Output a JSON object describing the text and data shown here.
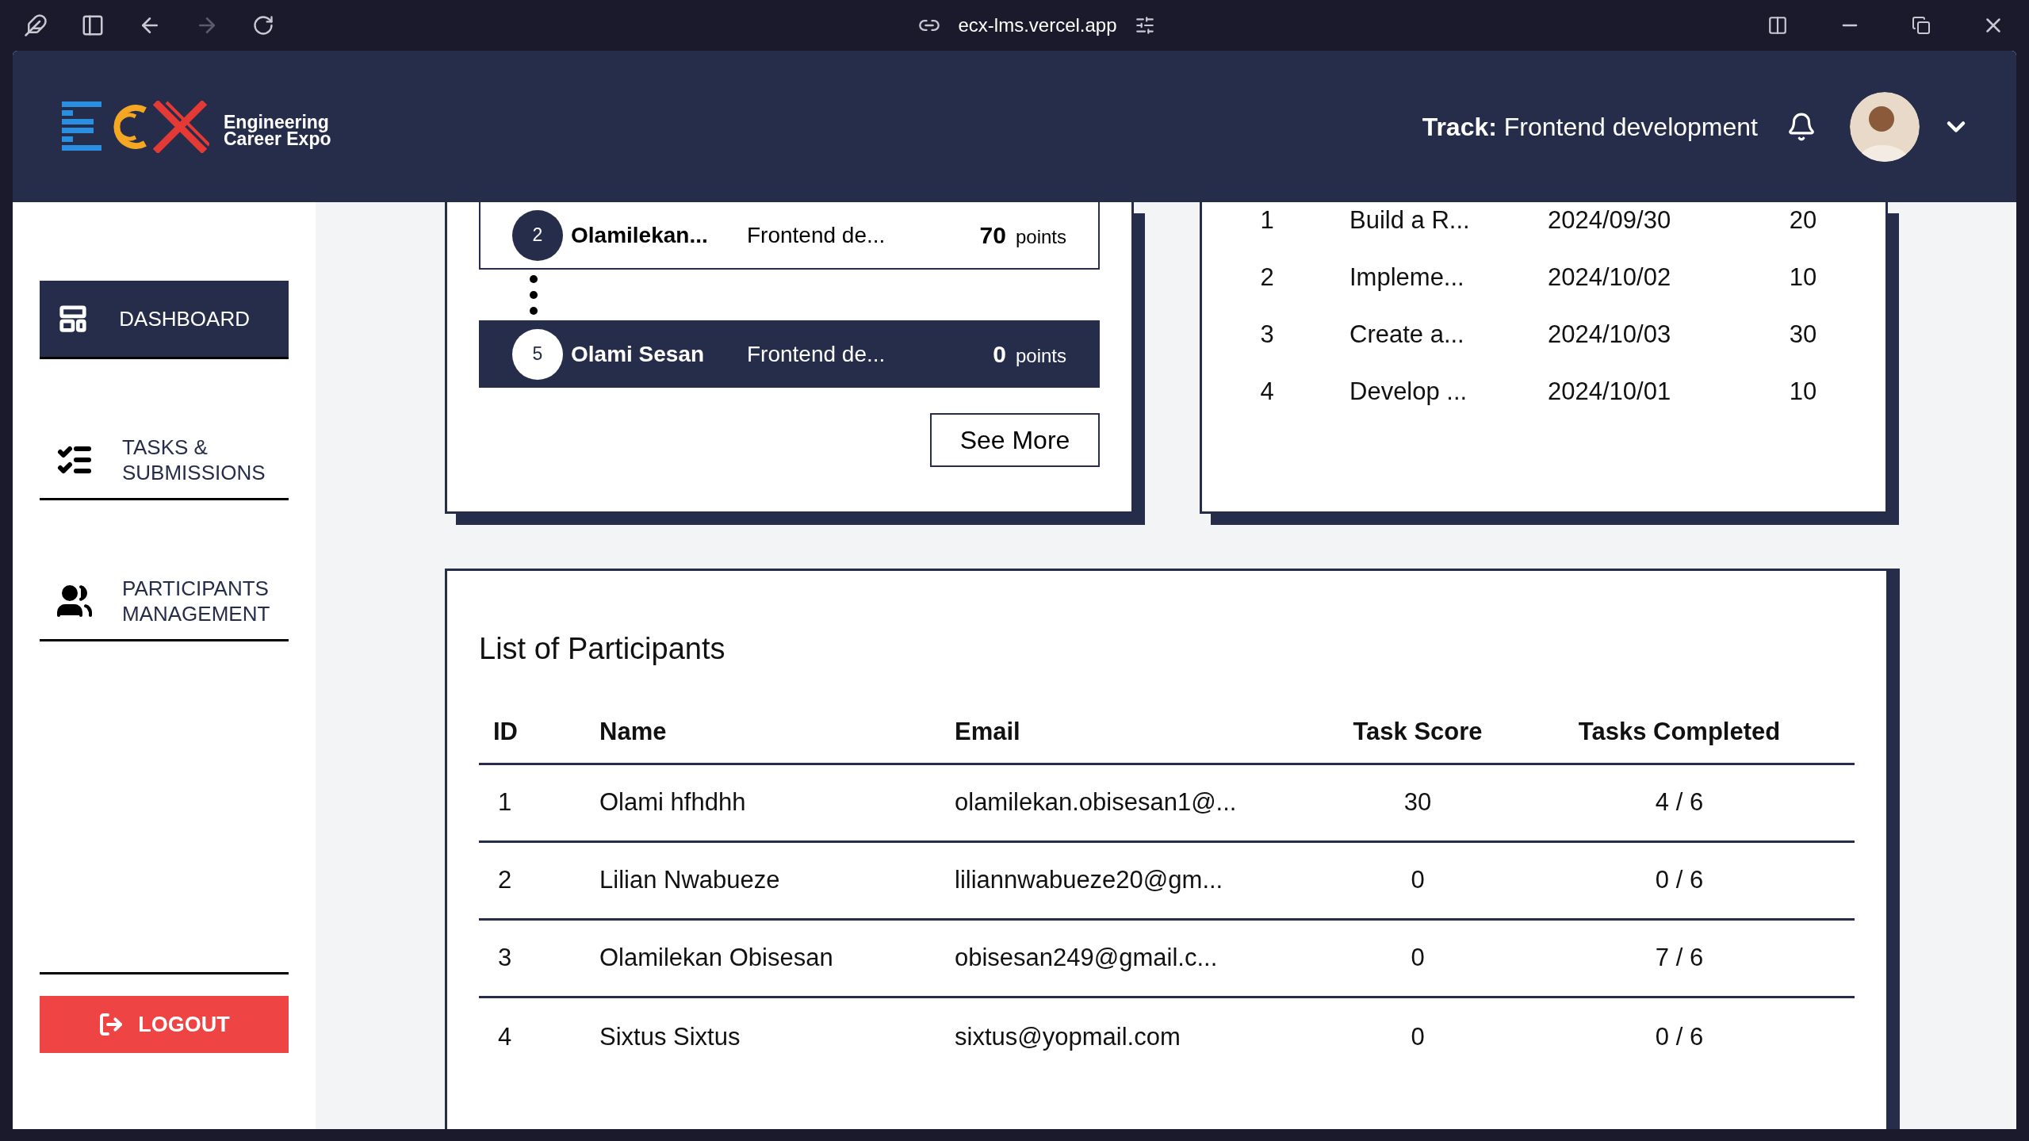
{
  "browser": {
    "url": "ecx-lms.vercel.app"
  },
  "header": {
    "tagline_line1": "Engineering",
    "tagline_line2": "Career Expo",
    "track_label": "Track:",
    "track_value": "Frontend development"
  },
  "sidebar": {
    "items": [
      {
        "label": "DASHBOARD",
        "kind": "dashboard",
        "selected": true
      },
      {
        "label": "TASKS & SUBMISSIONS",
        "kind": "tasks",
        "selected": false
      },
      {
        "label": "PARTICIPANTS MANAGEMENT",
        "kind": "participants",
        "selected": false
      }
    ],
    "logout": "LOGOUT"
  },
  "leaderboard": {
    "entries": [
      {
        "kind": "entry",
        "rank": "2",
        "name": "Olamilekan...",
        "track": "Frontend de...",
        "points": "70",
        "unit": "points",
        "current_user": false
      },
      {
        "kind": "ellipsis"
      },
      {
        "kind": "entry",
        "rank": "5",
        "name": "Olami Sesan",
        "track": "Frontend de...",
        "points": "0",
        "unit": "points",
        "current_user": true
      }
    ],
    "see_more": "See More"
  },
  "tasks": {
    "rows": [
      {
        "id": "1",
        "title": "Build a R...",
        "due": "2024/09/30",
        "points": "20"
      },
      {
        "id": "2",
        "title": "Impleme...",
        "due": "2024/10/02",
        "points": "10"
      },
      {
        "id": "3",
        "title": "Create a...",
        "due": "2024/10/03",
        "points": "30"
      },
      {
        "id": "4",
        "title": "Develop ...",
        "due": "2024/10/01",
        "points": "10"
      }
    ]
  },
  "participants": {
    "title": "List of Participants",
    "columns": [
      "ID",
      "Name",
      "Email",
      "Task Score",
      "Tasks Completed"
    ],
    "rows": [
      [
        "1",
        "Olami hfhdhh",
        "olamilekan.obisesan1@...",
        "30",
        "4 / 6"
      ],
      [
        "2",
        "Lilian Nwabueze",
        "liliannwabueze20@gm...",
        "0",
        "0 / 6"
      ],
      [
        "3",
        "Olamilekan Obisesan",
        "obisesan249@gmail.c...",
        "0",
        "7 / 6"
      ],
      [
        "4",
        "Sixtus Sixtus",
        "sixtus@yopmail.com",
        "0",
        "0 / 6"
      ]
    ]
  }
}
